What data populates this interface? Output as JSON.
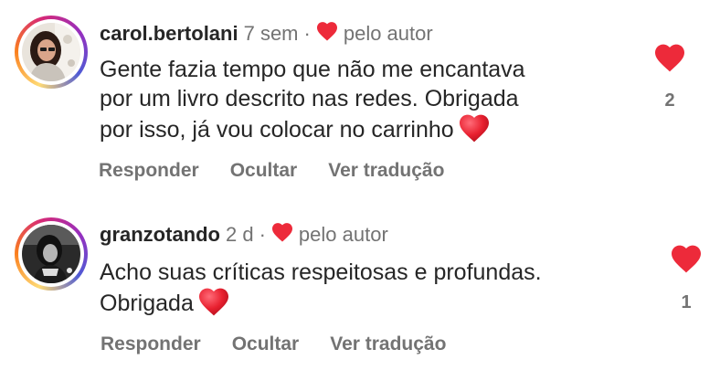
{
  "colors": {
    "heart_red": "#ed2a3a",
    "muted_text": "#737373",
    "primary_text": "#262626"
  },
  "comments": [
    {
      "username": "carol.bertolani",
      "time": "7 sem",
      "separator": "·",
      "author_like_label": "pelo autor",
      "text_lines": [
        "Gente fazia tempo que não me encantava",
        "por um livro descrito nas redes. Obrigada",
        "por isso, já vou colocar no carrinho"
      ],
      "text_emoji": "heart-emoji",
      "actions": {
        "reply": "Responder",
        "hide": "Ocultar",
        "translate": "Ver tradução"
      },
      "like_count": "2"
    },
    {
      "username": "granzotando",
      "time": "2 d",
      "separator": "·",
      "author_like_label": "pelo autor",
      "text_lines": [
        "Acho suas críticas respeitosas e profundas.",
        "Obrigada"
      ],
      "text_emoji": "heart-emoji",
      "actions": {
        "reply": "Responder",
        "hide": "Ocultar",
        "translate": "Ver tradução"
      },
      "like_count": "1"
    }
  ]
}
